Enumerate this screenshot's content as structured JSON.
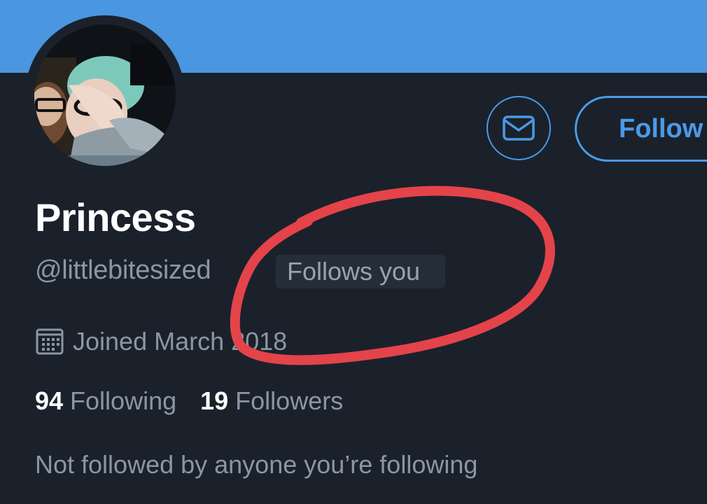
{
  "profile": {
    "display_name": "Princess",
    "handle": "@littlebitesized",
    "follows_you_badge": "Follows you",
    "joined": "Joined March 2018",
    "following_count": "94",
    "following_label": "Following",
    "followers_count": "19",
    "followers_label": "Followers",
    "mutuals_note": "Not followed by anyone you’re following"
  },
  "actions": {
    "follow_label": "Follow",
    "message_icon": "envelope-icon"
  },
  "icons": {
    "joined": "calendar-icon"
  },
  "colors": {
    "banner": "#4a96e0",
    "background": "#1b212b",
    "accent": "#4b9ae6",
    "secondary_text": "#8a97a4",
    "annotation": "#e4434a"
  }
}
